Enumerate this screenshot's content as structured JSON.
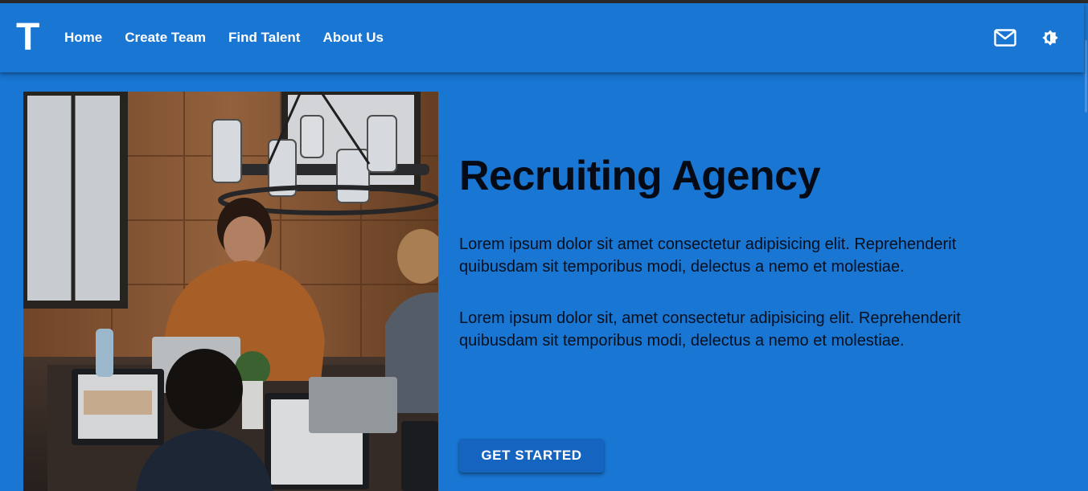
{
  "appbar": {
    "logo": "T",
    "nav": [
      {
        "label": "Home"
      },
      {
        "label": "Create Team"
      },
      {
        "label": "Find Talent"
      },
      {
        "label": "About Us"
      }
    ],
    "icons": [
      "mail-icon",
      "brightness-icon"
    ]
  },
  "hero": {
    "image": "team-working-on-laptops-photo",
    "title": "Recruiting Agency",
    "paragraphs": [
      "Lorem ipsum dolor sit amet consectetur adipisicing elit. Reprehenderit quibusdam sit temporibus modi, delectus a nemo et molestiae.",
      "Lorem ipsum dolor sit, amet consectetur adipisicing elit. Reprehenderit quibusdam sit temporibus modi, delectus a nemo et molestiae."
    ],
    "cta_label": "Get Started"
  },
  "colors": {
    "primary": "#1976d2",
    "button": "#1565c0",
    "text_dark": "#050a14"
  }
}
